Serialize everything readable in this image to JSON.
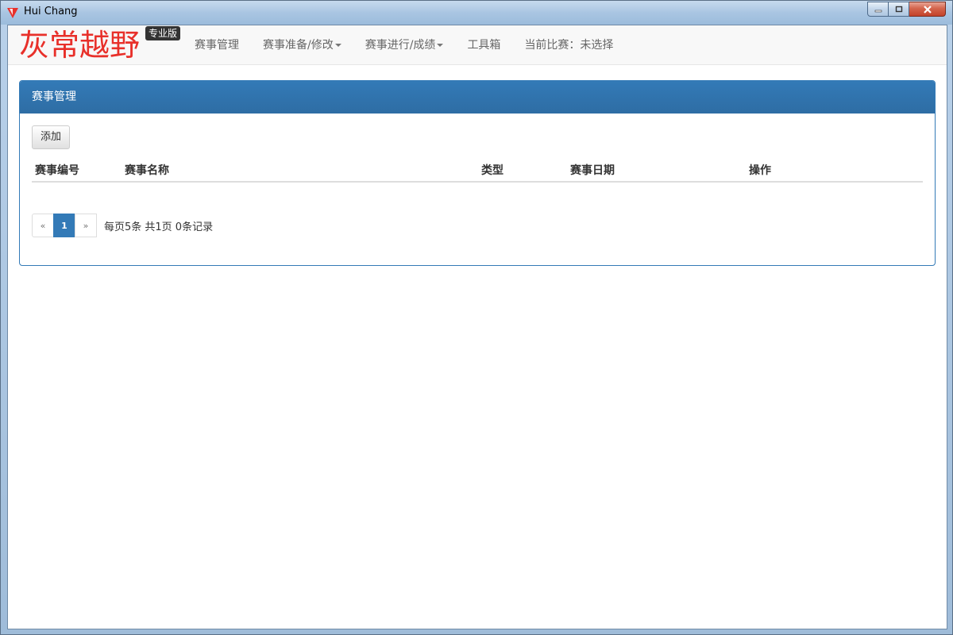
{
  "window": {
    "title": "Hui Chang"
  },
  "navbar": {
    "brand": "灰常越野",
    "badge": "专业版",
    "items": [
      {
        "label": "赛事管理",
        "dropdown": false
      },
      {
        "label": "赛事准备/修改",
        "dropdown": true
      },
      {
        "label": "赛事进行/成绩",
        "dropdown": true
      },
      {
        "label": "工具箱",
        "dropdown": false
      },
      {
        "label": "当前比赛：未选择",
        "dropdown": false
      }
    ]
  },
  "panel": {
    "heading": "赛事管理",
    "add_button": "添加",
    "columns": [
      "赛事编号",
      "赛事名称",
      "类型",
      "赛事日期",
      "操作"
    ],
    "rows": []
  },
  "pagination": {
    "prev": "«",
    "current_page": "1",
    "next": "»",
    "info": "每页5条 共1页 0条记录"
  },
  "colors": {
    "brand": "#e8302a",
    "accent": "#337ab7"
  }
}
